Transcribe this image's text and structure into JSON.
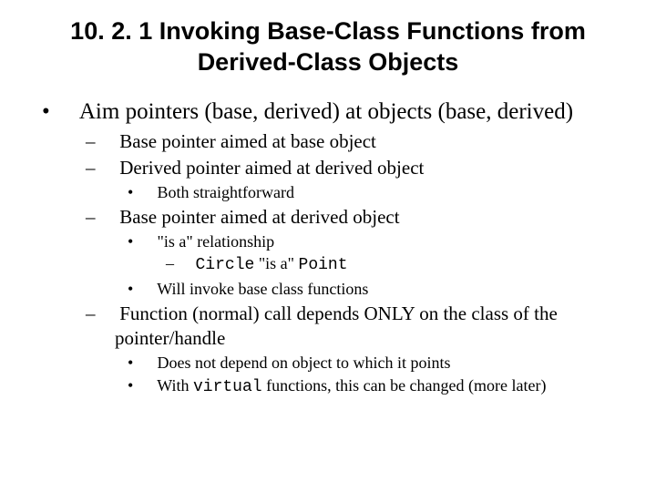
{
  "title": "10. 2. 1 Invoking Base-Class Functions from Derived-Class Objects",
  "b1": "Aim pointers (base, derived) at objects (base, derived)",
  "b1_1": "Base pointer aimed at base object",
  "b1_2": "Derived pointer aimed at derived object",
  "b1_2_1": "Both straightforward",
  "b1_3": "Base pointer aimed at derived object",
  "b1_3_1": "\"is a\" relationship",
  "b1_3_1_1a": "Circle",
  "b1_3_1_1b": " \"is a\" ",
  "b1_3_1_1c": "Point",
  "b1_3_2": "Will invoke base class functions",
  "b1_4": "Function (normal) call depends ONLY on the class of the pointer/handle",
  "b1_4_1": "Does not depend on object to which it points",
  "b1_4_2a": "With ",
  "b1_4_2b": "virtual",
  "b1_4_2c": " functions, this can be changed (more later)"
}
